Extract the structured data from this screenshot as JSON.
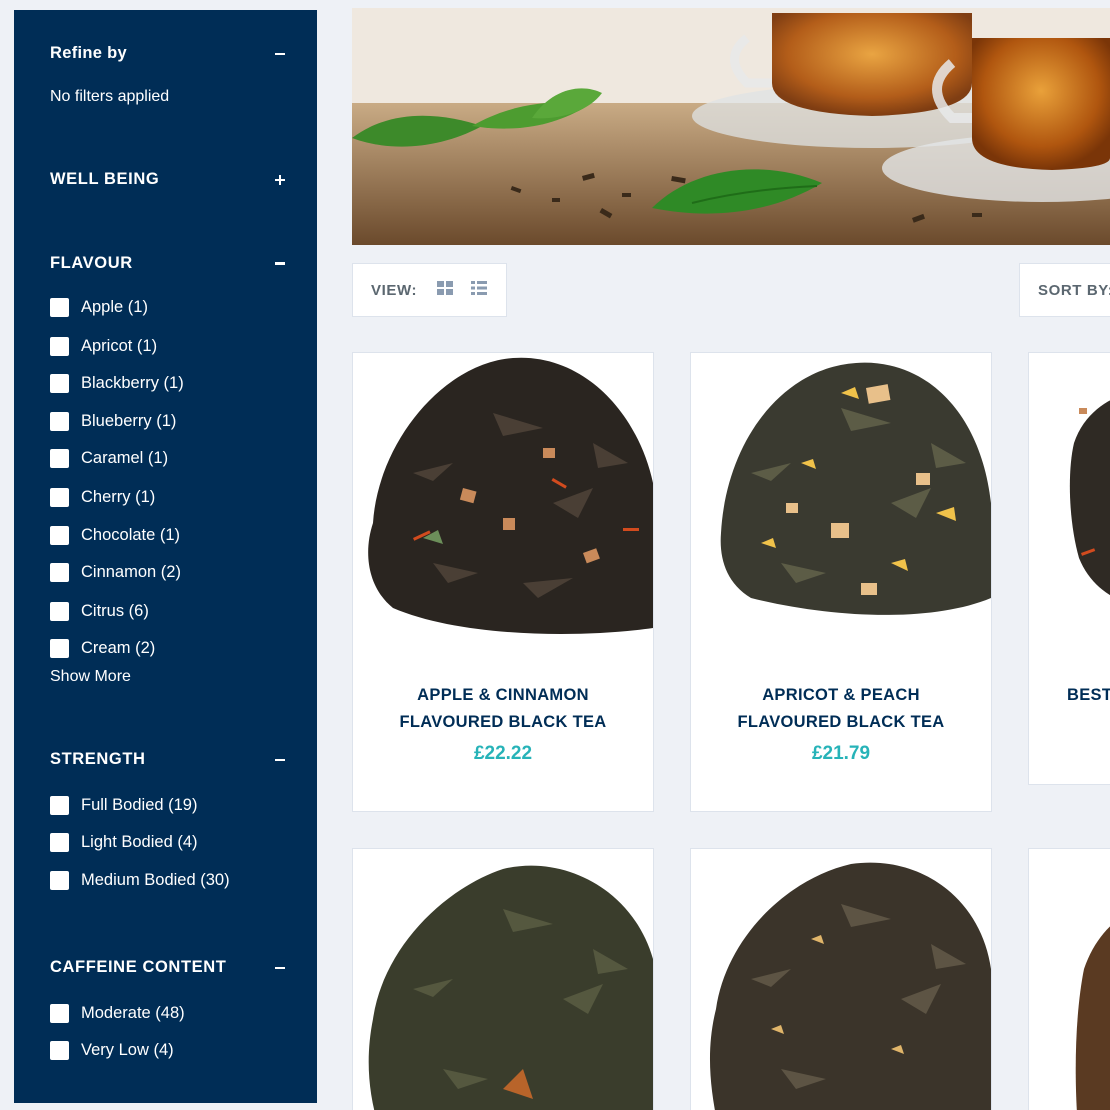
{
  "refine": {
    "title": "Refine by",
    "status": "No filters applied"
  },
  "well_being": {
    "title": "WELL BEING"
  },
  "flavour": {
    "title": "FLAVOUR",
    "options": [
      "Apple (1)",
      "Apricot (1)",
      "Blackberry (1)",
      "Blueberry (1)",
      "Caramel (1)",
      "Cherry (1)",
      "Chocolate (1)",
      "Cinnamon (2)",
      "Citrus (6)",
      "Cream (2)"
    ],
    "show_more": "Show More"
  },
  "strength": {
    "title": "STRENGTH",
    "options": [
      "Full Bodied (19)",
      "Light Bodied (4)",
      "Medium Bodied (30)"
    ]
  },
  "caffeine": {
    "title": "CAFFEINE CONTENT",
    "options": [
      "Moderate (48)",
      "Very Low (4)"
    ]
  },
  "toolbar": {
    "view_label": "VIEW:",
    "sort_label": "SORT BY:"
  },
  "products": [
    {
      "line1": "APPLE & CINNAMON",
      "line2": "FLAVOURED BLACK TEA",
      "price": "£22.22"
    },
    {
      "line1": "APRICOT & PEACH",
      "line2": "FLAVOURED BLACK TEA",
      "price": "£21.79"
    },
    {
      "line1": "BEST",
      "line2": "",
      "price": ""
    }
  ],
  "colors": {
    "sidebar": "#002d56",
    "page": "#eef1f6",
    "title": "#002d56",
    "price": "#27b3b8"
  }
}
